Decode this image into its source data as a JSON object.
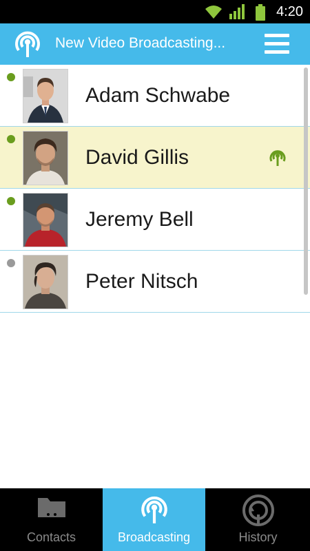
{
  "status_bar": {
    "time": "4:20",
    "icons": [
      "wifi-icon",
      "signal-icon",
      "battery-icon"
    ]
  },
  "header": {
    "title": "New Video Broadcasting...",
    "logo_icon": "broadcast-icon",
    "menu_icon": "menu-icon"
  },
  "contacts": [
    {
      "name": "Adam Schwabe",
      "status": "online",
      "status_color": "#6a9d1e",
      "broadcasting": false
    },
    {
      "name": "David Gillis",
      "status": "online",
      "status_color": "#6a9d1e",
      "broadcasting": true
    },
    {
      "name": "Jeremy Bell",
      "status": "online",
      "status_color": "#6a9d1e",
      "broadcasting": false
    },
    {
      "name": "Peter Nitsch",
      "status": "offline",
      "status_color": "#9a9a9a",
      "broadcasting": false
    }
  ],
  "bottom_nav": {
    "tabs": [
      {
        "label": "Contacts",
        "icon": "folder-icon",
        "active": false
      },
      {
        "label": "Broadcasting",
        "icon": "broadcast-icon",
        "active": true
      },
      {
        "label": "History",
        "icon": "history-icon",
        "active": false
      }
    ]
  },
  "colors": {
    "accent": "#45baea",
    "highlight_row": "#f7f4cc",
    "online": "#6a9d1e",
    "offline": "#9a9a9a"
  }
}
